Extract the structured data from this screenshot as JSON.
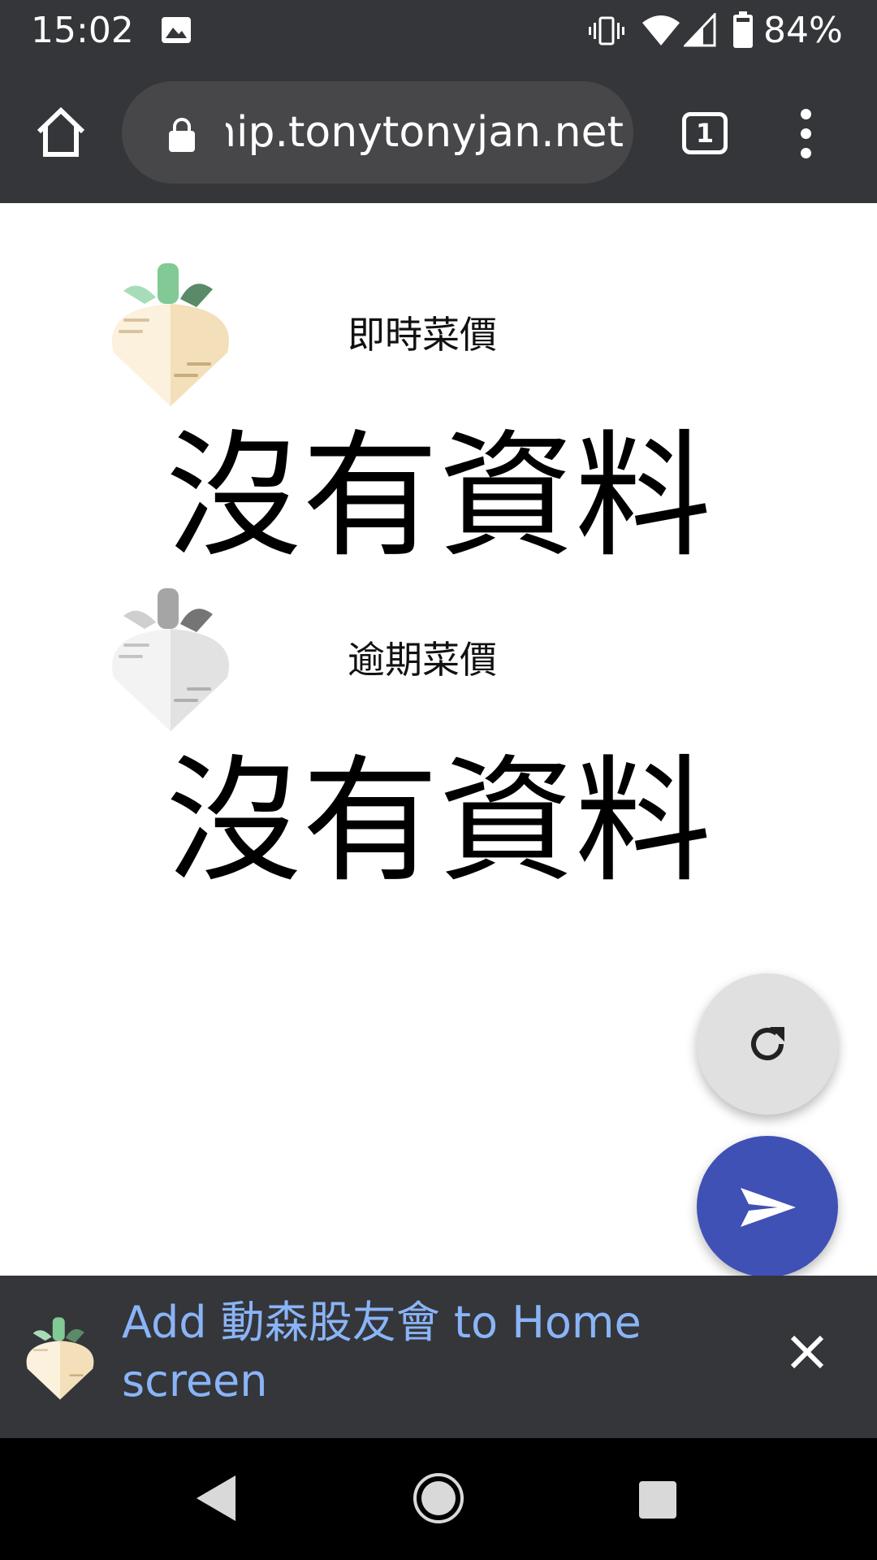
{
  "status_bar": {
    "time": "15:02",
    "battery": "84%"
  },
  "browser": {
    "url": "tw-vegetables-price-ship.tonytonyjan.net",
    "tab_count": "1"
  },
  "sections": [
    {
      "label": "即時菜價",
      "message": "沒有資料"
    },
    {
      "label": "逾期菜價",
      "message": "沒有資料"
    }
  ],
  "fab": {
    "refresh_icon": "refresh-icon",
    "send_icon": "send-icon",
    "send_color": "#3f51b5"
  },
  "a2hs_banner": {
    "text": "Add 動森股友會 to Home screen"
  },
  "colors": {
    "browser_chrome": "#35363a",
    "banner_link": "#8ab4f8"
  }
}
